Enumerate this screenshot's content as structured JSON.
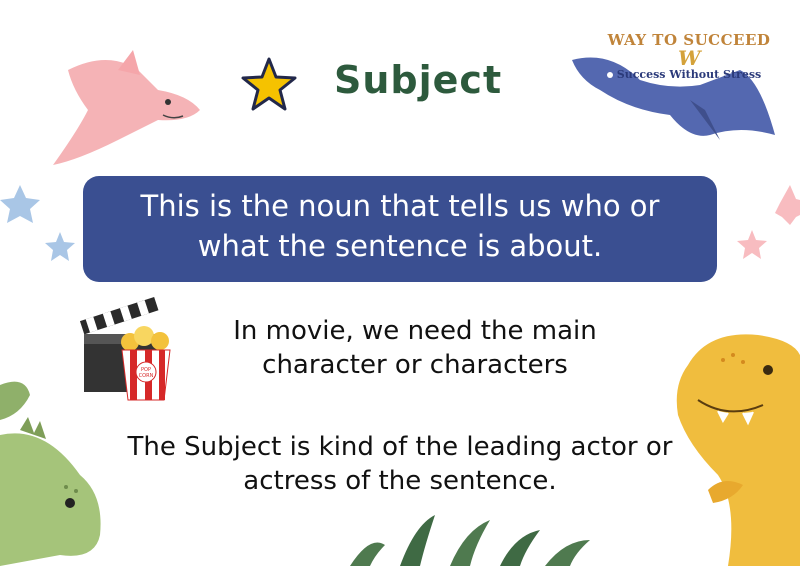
{
  "title": "Subject",
  "definition": {
    "line1": "This is the noun that tells us who or",
    "line2": "what the sentence is about."
  },
  "movie": {
    "line1": "In movie, we need the main",
    "line2": "character or characters"
  },
  "actor": {
    "line1": "The Subject is kind of the leading actor or",
    "line2": "actress of the sentence."
  },
  "logo": {
    "top": "WAY TO SUCCEED",
    "mark": "W",
    "bottom": "Success Without Stress"
  },
  "popcorn_label": "POP CORN",
  "colors": {
    "title": "#2d5a3d",
    "definition_box": "#3a4f91",
    "star": "#f5c200",
    "logo_top": "#c0843a",
    "logo_bottom": "#2b3a7a"
  },
  "icons": [
    "star-icon",
    "pink-pterodactyl",
    "blue-pterodactyl",
    "film-clapper-icon",
    "popcorn-icon",
    "yellow-dinosaur",
    "green-dinosaur",
    "blue-stars",
    "pink-stars",
    "grass-leaves"
  ]
}
